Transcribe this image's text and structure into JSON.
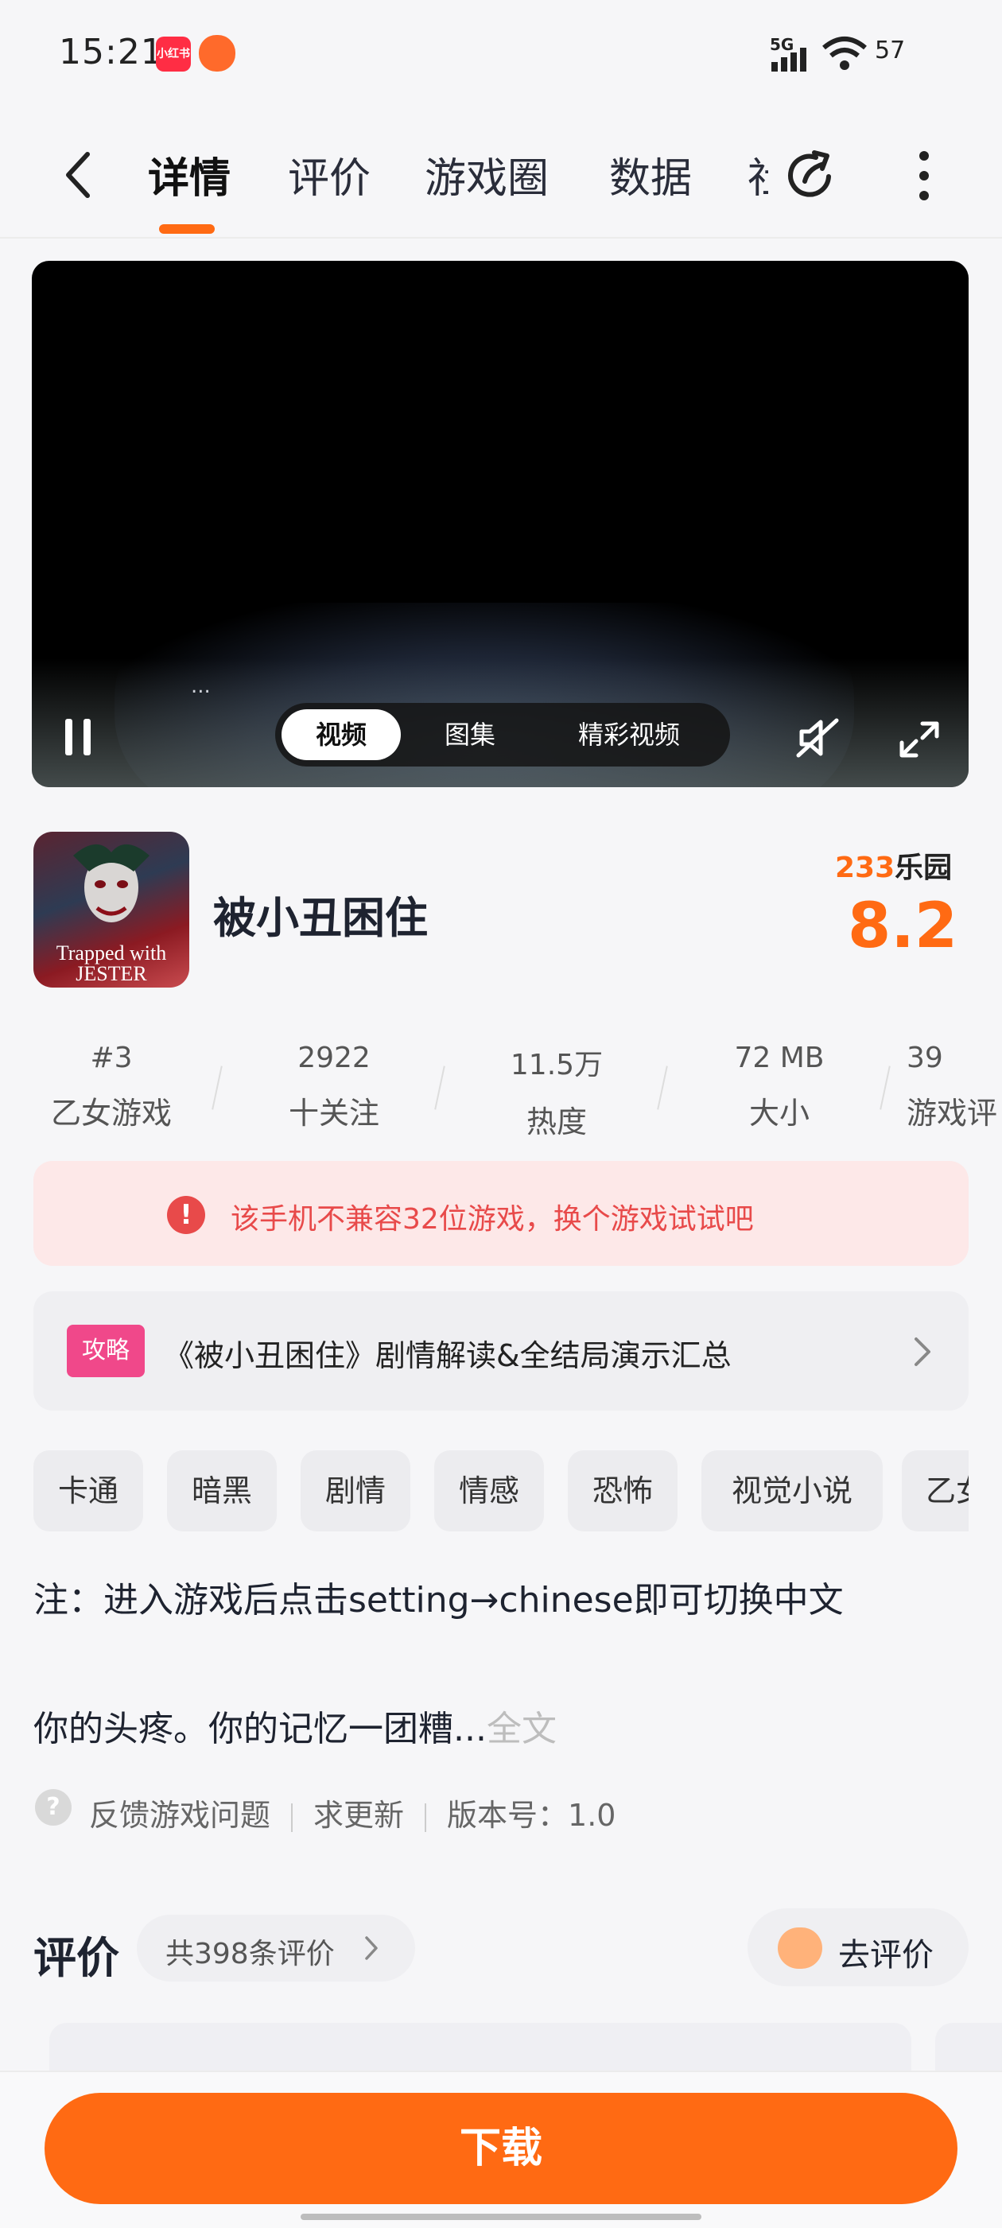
{
  "status_bar": {
    "time": "15:21",
    "network": "5G",
    "battery": "57",
    "app_icon_1_label": "小红书"
  },
  "tabs": [
    "详情",
    "评价",
    "游戏圈",
    "数据",
    "社"
  ],
  "video": {
    "segments": [
      "视频",
      "图集",
      "精彩视频"
    ],
    "dots": "..."
  },
  "game": {
    "title": "被小丑困住",
    "icon_text": "Trapped with JESTER",
    "brand_num": "233",
    "brand_text": "乐园",
    "score": "8.2"
  },
  "stats": [
    {
      "value": "#3",
      "label": "乙女游戏"
    },
    {
      "value": "2922",
      "label": "十关注"
    },
    {
      "value": "11.5万",
      "label": "热度"
    },
    {
      "value": "72 MB",
      "label": "大小"
    },
    {
      "value": "39",
      "label": "游戏评"
    }
  ],
  "warning": {
    "icon": "!",
    "text": "该手机不兼容32位游戏，换个游戏试试吧"
  },
  "guide": {
    "badge": "攻略",
    "text": "《被小丑困住》剧情解读&全结局演示汇总"
  },
  "tags": [
    "卡通",
    "暗黑",
    "剧情",
    "情感",
    "恐怖",
    "视觉小说",
    "乙女"
  ],
  "description": {
    "note": "注：进入游戏后点击setting→chinese即可切换中文",
    "text": "你的头疼。你的记忆一团糟...",
    "more": "全文"
  },
  "feedback": {
    "icon": "?",
    "report": "反馈游戏问题",
    "request_update": "求更新",
    "version": "版本号：1.0"
  },
  "reviews": {
    "title": "评价",
    "count": "共398条评价",
    "button": "去评价"
  },
  "download_label": "下载",
  "colors": {
    "accent": "#ff6a13",
    "warning": "#e84a4a",
    "guide_badge": "#f0488a"
  }
}
